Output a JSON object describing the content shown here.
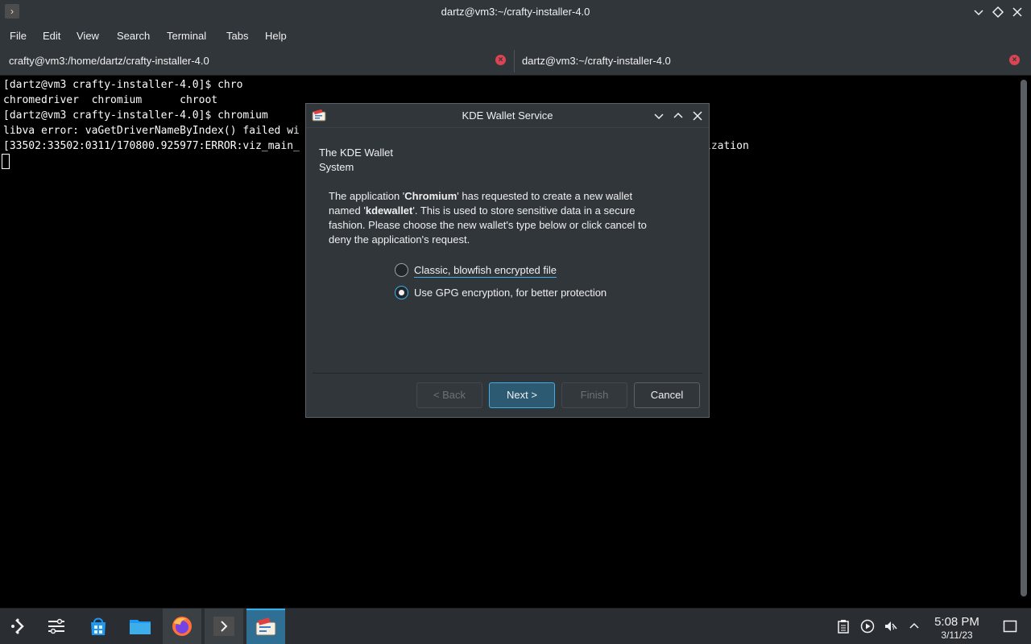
{
  "window": {
    "title": "dartz@vm3:~/crafty-installer-4.0",
    "app_icon": "terminal-icon"
  },
  "menu": [
    "File",
    "Edit",
    "View",
    "Search",
    "Terminal",
    "Tabs",
    "Help"
  ],
  "tabs": [
    {
      "label": "crafty@vm3:/home/dartz/crafty-installer-4.0",
      "close": "×"
    },
    {
      "label": "dartz@vm3:~/crafty-installer-4.0",
      "close": "×"
    }
  ],
  "terminal": {
    "lines": [
      "[dartz@vm3 crafty-installer-4.0]$ chro",
      "chromedriver  chromium      chroot",
      "[dartz@vm3 crafty-installer-4.0]$ chromium",
      "libva error: vaGetDriverNameByIndex() failed wi",
      "[33502:33502:0311/170800.925977:ERROR:viz_main_"
    ],
    "trailing_fragment": "ization"
  },
  "dialog": {
    "title": "KDE Wallet Service",
    "heading_line1": "The KDE Wallet",
    "heading_line2": "System",
    "p1_a": "The application '",
    "p1_b": "Chromium",
    "p1_c": "' has requested to create a new wallet",
    "p2_a": "named '",
    "p2_b": "kdewallet",
    "p2_c": "'. This is used to store sensitive data in a secure",
    "p3": "fashion. Please choose the new wallet's type below or click cancel to",
    "p4": "deny the application's request.",
    "options": [
      {
        "label": "Classic, blowfish encrypted file",
        "checked": false
      },
      {
        "label": "Use GPG encryption, for better protection",
        "checked": true
      }
    ],
    "buttons": {
      "back": "< Back",
      "next": "Next >",
      "finish": "Finish",
      "cancel": "Cancel"
    }
  },
  "taskbar": {
    "items": [
      "application-launcher-icon",
      "settings-sliders-icon",
      "discover-store-icon",
      "file-manager-icon",
      "firefox-icon",
      "konsole-icon",
      "kwallet-icon"
    ],
    "tray": [
      "clipboard-icon",
      "media-player-icon",
      "volume-muted-icon",
      "chevron-up-icon"
    ],
    "clock_time": "5:08 PM",
    "clock_date": "3/11/23",
    "show_desktop": "show-desktop-icon"
  },
  "colors": {
    "accent": "#3daee9",
    "chrome_bg": "#31363b",
    "close_red": "#da4453"
  }
}
